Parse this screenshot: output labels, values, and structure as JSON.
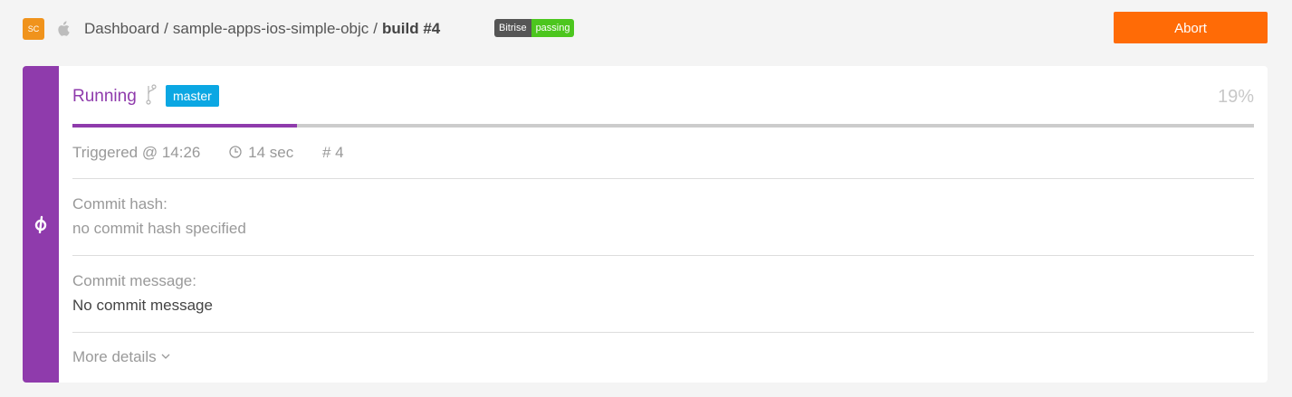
{
  "header": {
    "avatar_initials": "SC",
    "avatar_color": "#f0931c",
    "platform_icon": "apple-icon",
    "breadcrumb": {
      "root": "Dashboard",
      "separator": "/",
      "app": "sample-apps-ios-simple-objc",
      "current": "build #4"
    },
    "badge": {
      "name": "Bitrise",
      "state": "passing",
      "state_color": "#4cc61e"
    },
    "abort_label": "Abort",
    "abort_color": "#ff6b06"
  },
  "build": {
    "accent_color": "#8f3bac",
    "side_icon": "commit-icon",
    "status": "Running",
    "branch_icon": "branch-icon",
    "branch": "master",
    "progress_fraction": 0.19,
    "progress_label": "19%",
    "triggered": "Triggered @ 14:26",
    "duration_icon": "clock-icon",
    "duration": "14 sec",
    "build_number": "# 4",
    "commit_hash_label": "Commit hash:",
    "commit_hash_value": "no commit hash specified",
    "commit_message_label": "Commit message:",
    "commit_message_value": "No commit message",
    "more_details_label": "More details"
  }
}
